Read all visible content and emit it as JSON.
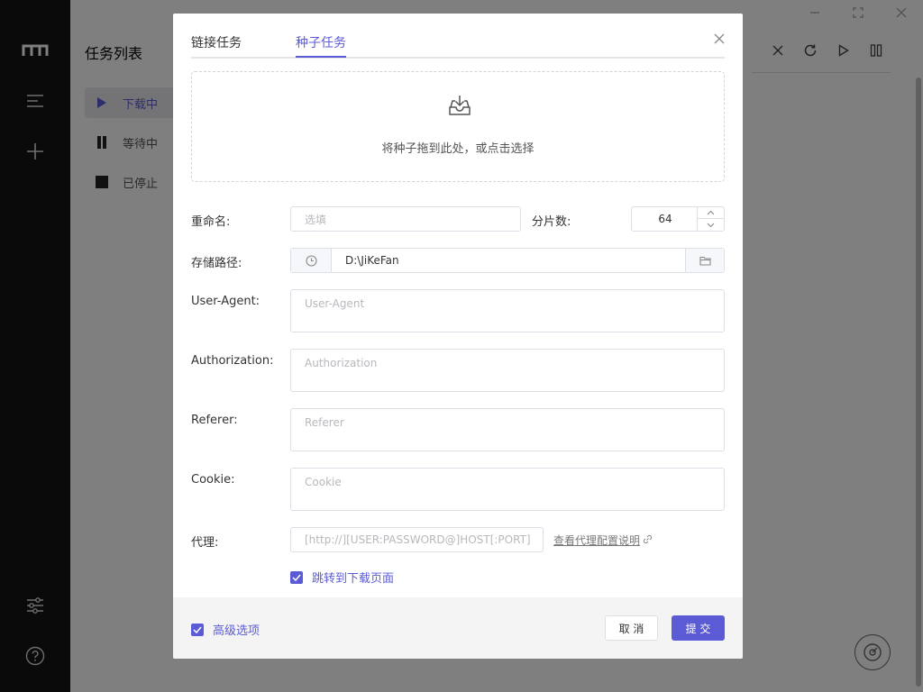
{
  "app": {
    "tasklist_title": "任务列表",
    "tasks": [
      {
        "label": "下载中",
        "icon": "play-icon"
      },
      {
        "label": "等待中",
        "icon": "pause-icon"
      },
      {
        "label": "已停止",
        "icon": "stop-icon"
      }
    ]
  },
  "dialog": {
    "tabs": [
      {
        "label": "链接任务"
      },
      {
        "label": "种子任务"
      }
    ],
    "active_tab": 1,
    "dropzone_text": "将种子拖到此处，或点击选择",
    "fields": {
      "rename_label": "重命名:",
      "rename_placeholder": "选填",
      "split_label": "分片数:",
      "split_value": "64",
      "path_label": "存储路径:",
      "path_value": "D:\\JiKeFan",
      "ua_label": "User-Agent:",
      "ua_placeholder": "User-Agent",
      "auth_label": "Authorization:",
      "auth_placeholder": "Authorization",
      "referer_label": "Referer:",
      "referer_placeholder": "Referer",
      "cookie_label": "Cookie:",
      "cookie_placeholder": "Cookie",
      "proxy_label": "代理:",
      "proxy_placeholder": "[http://][USER:PASSWORD@]HOST[:PORT]",
      "proxy_help": "查看代理配置说明"
    },
    "jump_checkbox": {
      "label": "跳转到下载页面",
      "checked": true
    },
    "advanced_checkbox": {
      "label": "高级选项",
      "checked": true
    },
    "cancel_label": "取 消",
    "submit_label": "提 交"
  },
  "colors": {
    "accent": "#5b5bd6",
    "sidebar": "#141414"
  }
}
